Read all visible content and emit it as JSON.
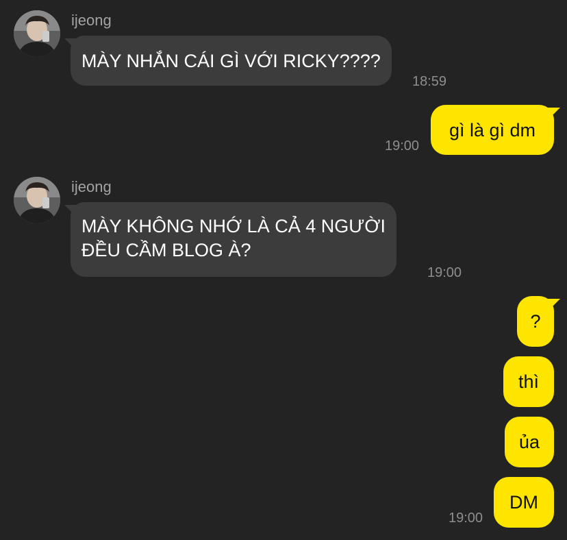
{
  "colors": {
    "background": "#232323",
    "incoming_bubble": "#3c3c3d",
    "outgoing_bubble": "#fee500",
    "sender_name": "#a3a3a3",
    "timestamp": "#8e8e8e"
  },
  "messages": [
    {
      "direction": "incoming",
      "sender": "ijeong",
      "lines": [
        "MÀY NHẮN CÁI GÌ VỚI RICKY????"
      ],
      "time": "18:59"
    },
    {
      "direction": "outgoing",
      "lines": [
        "gì là gì dm"
      ],
      "time": "19:00"
    },
    {
      "direction": "incoming",
      "sender": "ijeong",
      "lines": [
        "MÀY KHÔNG NHỚ LÀ CẢ 4 NGƯỜI",
        "ĐỀU CẦM BLOG À?"
      ],
      "time": "19:00"
    },
    {
      "direction": "outgoing",
      "lines": [
        "?"
      ]
    },
    {
      "direction": "outgoing",
      "lines": [
        "thì"
      ]
    },
    {
      "direction": "outgoing",
      "lines": [
        "ủa"
      ]
    },
    {
      "direction": "outgoing",
      "lines": [
        "DM"
      ],
      "time": "19:00"
    }
  ]
}
